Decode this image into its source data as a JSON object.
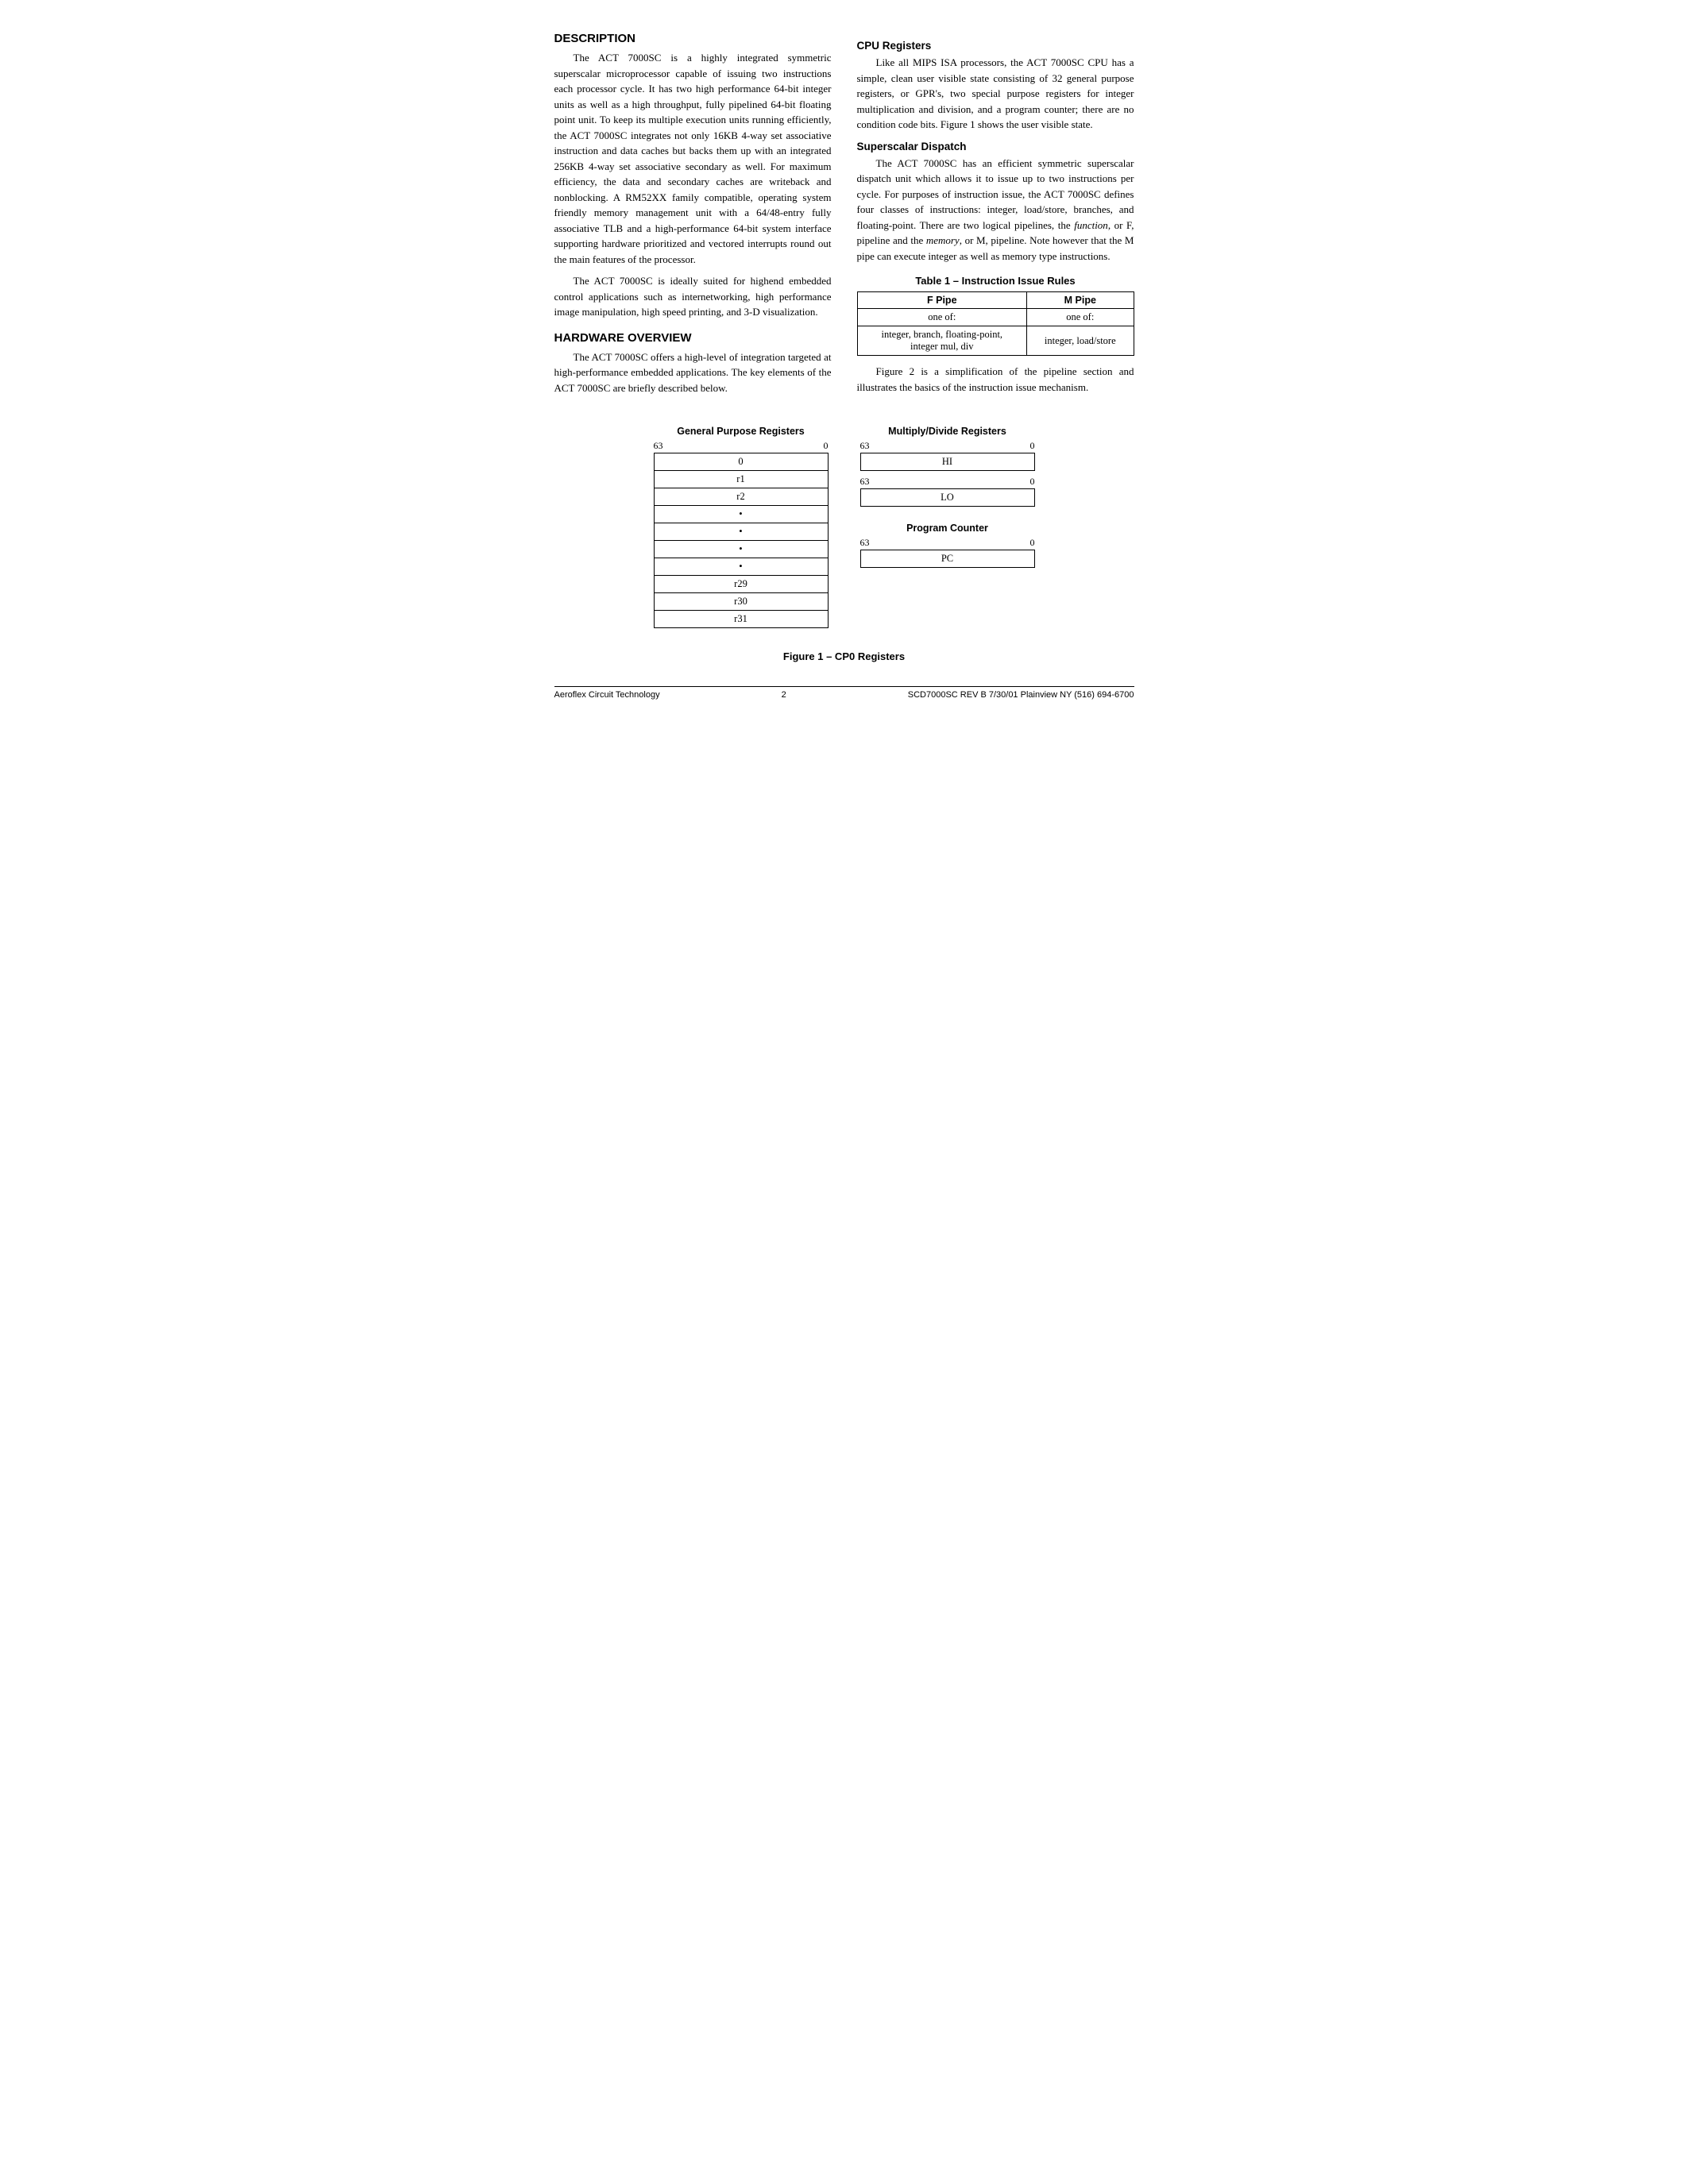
{
  "sections": {
    "description": {
      "title": "DESCRIPTION",
      "paragraphs": [
        "The ACT 7000SC is a highly integrated symmetric superscalar microprocessor capable of issuing two instructions each processor cycle. It has two high performance 64-bit integer units as well as a high throughput, fully pipelined 64-bit floating point unit. To keep its multiple execution units running efficiently, the ACT 7000SC integrates not only 16KB 4-way set associative instruction and data caches but backs them up with an integrated 256KB 4-way set associative secondary as well. For maximum efficiency, the data and secondary caches are writeback and nonblocking. A RM52XX family compatible, operating system friendly memory management unit with a 64/48-entry fully associative TLB and a high-performance 64-bit system interface supporting hardware prioritized and vectored interrupts round out the main features of the processor.",
        "The ACT 7000SC is ideally suited for highend embedded control applications such as internetworking, high performance image manipulation, high speed printing, and 3-D visualization."
      ]
    },
    "hardware_overview": {
      "title": "HARDWARE OVERVIEW",
      "paragraphs": [
        "The ACT 7000SC offers a high-level of integration targeted at high-performance embedded applications. The key elements of the ACT 7000SC are briefly described below."
      ]
    },
    "cpu_registers": {
      "title": "CPU Registers",
      "paragraphs": [
        "Like all MIPS ISA processors, the ACT 7000SC CPU has a simple, clean user visible state consisting of 32 general purpose registers, or GPR's, two special purpose registers for integer multiplication and division, and a program counter; there are no condition code bits. Figure 1 shows the user visible state."
      ]
    },
    "superscalar_dispatch": {
      "title": "Superscalar Dispatch",
      "paragraphs": [
        "The ACT 7000SC has an efficient symmetric superscalar dispatch unit which allows it to issue up to two instructions per cycle. For purposes of instruction issue, the ACT 7000SC defines four classes of instructions: integer, load/store, branches, and floating-point. There are two logical pipelines, the function, or F, pipeline and the memory, or M, pipeline. Note however that the M pipe can execute integer as well as memory type instructions.",
        "Figure 2 is a simplification of the pipeline section and illustrates the basics of the instruction issue mechanism."
      ]
    },
    "table1": {
      "title": "Table 1 – Instruction Issue Rules",
      "headers": [
        "F Pipe",
        "M Pipe"
      ],
      "rows": [
        [
          "one of:",
          "one of:"
        ],
        [
          "integer, branch, floating-point,\ninteger mul, div",
          "integer, load/store"
        ]
      ]
    }
  },
  "figure": {
    "caption": "Figure 1 – CP0 Registers",
    "gpr": {
      "title": "General Purpose Registers",
      "bit_high": "63",
      "bit_low": "0",
      "rows": [
        "0",
        "r1",
        "r2",
        "•",
        "•",
        "•",
        "•",
        "r29",
        "r30",
        "r31"
      ]
    },
    "multiply_divide": {
      "title": "Multiply/Divide Registers",
      "bit_high": "63",
      "bit_low": "0",
      "registers": [
        {
          "bits_high": "63",
          "bits_low": "0",
          "label": "HI"
        },
        {
          "bits_high": "63",
          "bits_low": "0",
          "label": "LO"
        }
      ]
    },
    "program_counter": {
      "title": "Program Counter",
      "bit_high": "63",
      "bit_low": "0",
      "label": "PC"
    }
  },
  "footer": {
    "left": "Aeroflex Circuit Technology",
    "center": "2",
    "right": "SCD7000SC REV B  7/30/01  Plainview NY (516) 694-6700"
  }
}
